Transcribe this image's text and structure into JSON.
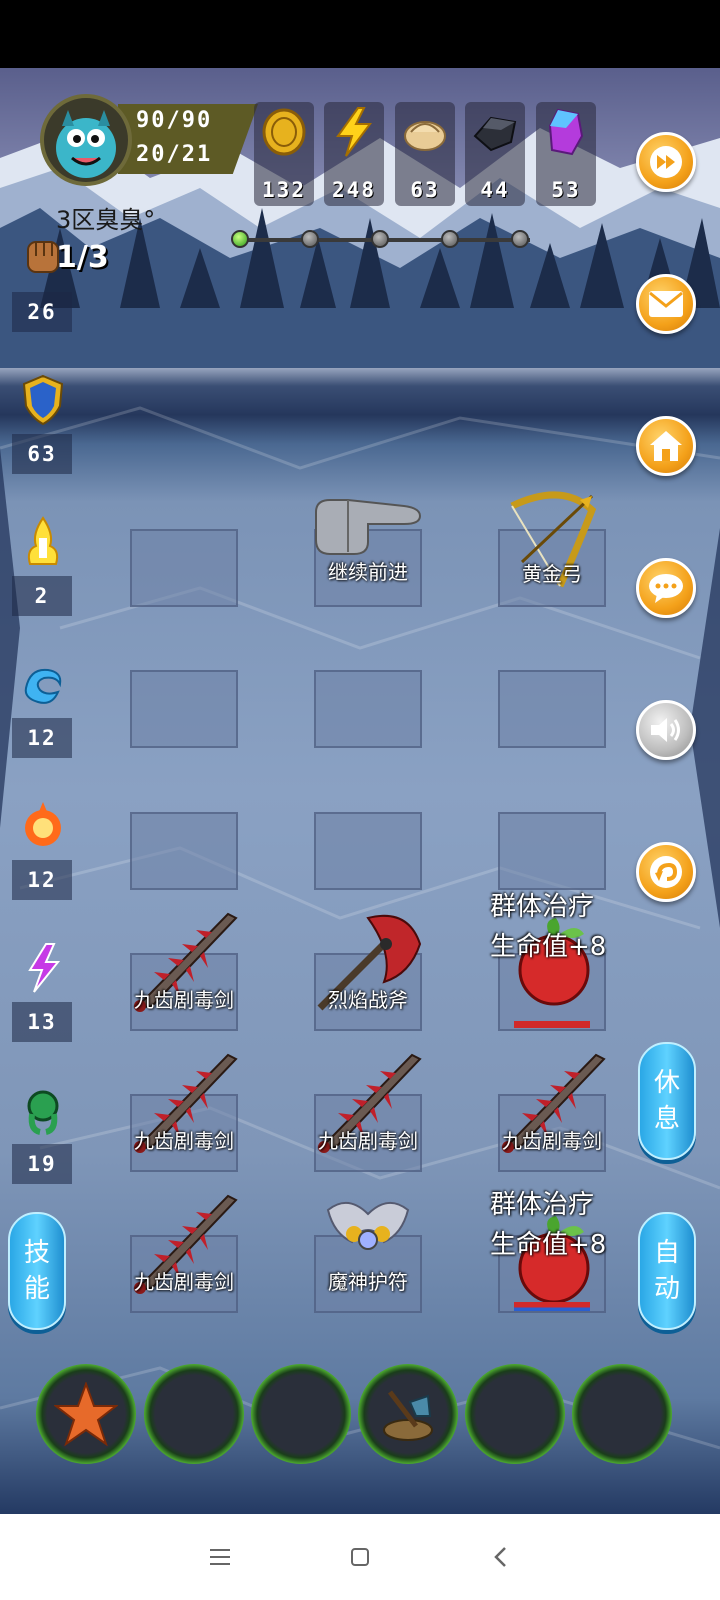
{
  "player": {
    "hp": "90/90",
    "energy": "20/21",
    "name": "3区臭臭°",
    "wave": "1/3"
  },
  "resources": [
    {
      "icon": "gold-coin-icon",
      "value": "132"
    },
    {
      "icon": "lightning-icon",
      "value": "248"
    },
    {
      "icon": "dumpling-icon",
      "value": "63"
    },
    {
      "icon": "iron-ore-icon",
      "value": "44"
    },
    {
      "icon": "purple-crystal-icon",
      "value": "53"
    }
  ],
  "stats": [
    {
      "icon": "fist-icon",
      "value": "26"
    },
    {
      "icon": "shield-icon",
      "value": "63"
    },
    {
      "icon": "holy-light-icon",
      "value": "2"
    },
    {
      "icon": "water-icon",
      "value": "12"
    },
    {
      "icon": "fire-icon",
      "value": "12"
    },
    {
      "icon": "lightning-rune-icon",
      "value": "13"
    },
    {
      "icon": "poison-icon",
      "value": "19"
    }
  ],
  "grid": {
    "continue_label": "继续前进",
    "golden_bow_label": "黄金弓",
    "sword_label": "九齿剧毒剑",
    "axe_label": "烈焰战斧",
    "amulet_label": "魔神护符",
    "heal_title": "群体治疗",
    "heal_sub_1": "生命值+8",
    "heal_sub_2": "生命值+8"
  },
  "buttons": {
    "rest": "休\n息",
    "rest_a": "休",
    "rest_b": "息",
    "auto_a": "自",
    "auto_b": "动",
    "skill_a": "技",
    "skill_b": "能"
  },
  "colors": {
    "accent_orange": "#f4a11a",
    "pill_blue": "#2aa7e6",
    "hp_red": "#d12a2a"
  }
}
